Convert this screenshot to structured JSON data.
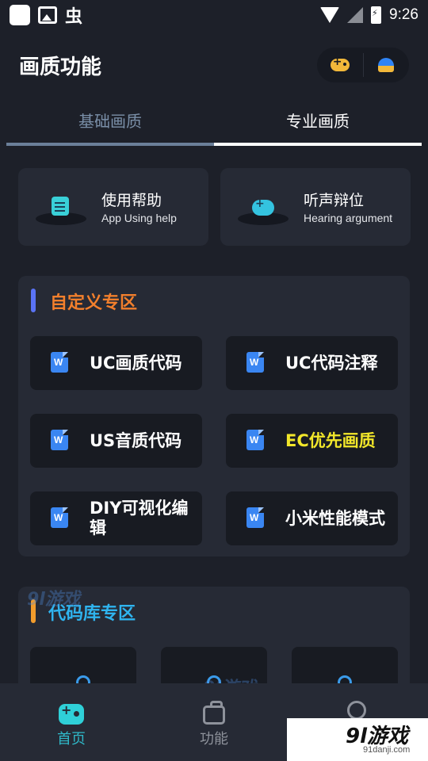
{
  "status_bar": {
    "time": "9:26",
    "bug_glyph": "虫"
  },
  "header": {
    "title": "画质功能",
    "actions": [
      {
        "icon": "gamepad-icon"
      },
      {
        "icon": "bell-icon"
      }
    ]
  },
  "tabs": [
    {
      "label": "基础画质",
      "active": false
    },
    {
      "label": "专业画质",
      "active": true
    }
  ],
  "help_cards": [
    {
      "title": "使用帮助",
      "subtitle": "App Using help",
      "icon": "document-icon"
    },
    {
      "title": "听声辩位",
      "subtitle": "Hearing argument",
      "icon": "gamepad-icon"
    }
  ],
  "custom_section": {
    "title": "自定义专区",
    "items": [
      {
        "label": "UC画质代码"
      },
      {
        "label": "UC代码注释"
      },
      {
        "label": "US音质代码"
      },
      {
        "label": "EC优先画质",
        "highlight_color": "#f2e72a"
      },
      {
        "label": "DIY可视化编辑"
      },
      {
        "label": "小米性能模式"
      }
    ]
  },
  "library_section": {
    "title": "代码库专区"
  },
  "bottom_nav": [
    {
      "label": "首页",
      "icon": "robot-icon",
      "active": true
    },
    {
      "label": "功能",
      "icon": "toolbox-icon",
      "active": false
    },
    {
      "label": "",
      "icon": "user-icon",
      "active": false
    }
  ],
  "watermark": {
    "text": "9l游戏",
    "url": "91danji.com"
  },
  "colors": {
    "background": "#1d2029",
    "card": "#262a35",
    "accent_orange": "#f27f2c",
    "accent_blue": "#2fb4ef",
    "accent_teal": "#2fb9c9",
    "highlight_yellow": "#f2e72a"
  }
}
